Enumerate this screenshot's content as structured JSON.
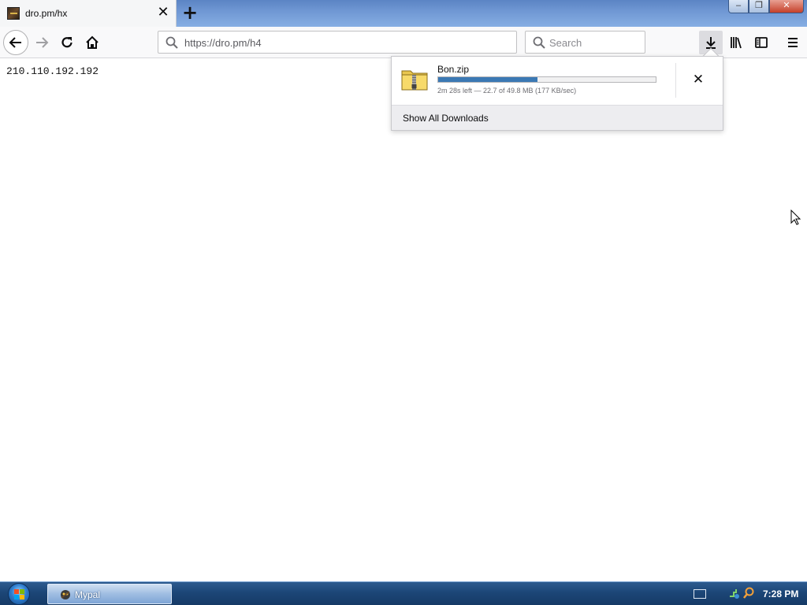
{
  "browser": {
    "tab": {
      "title": "dro.pm/hx"
    },
    "urlbar": {
      "url": "https://dro.pm/h4"
    },
    "searchbar": {
      "placeholder": "Search"
    }
  },
  "page": {
    "content_text": "210.110.192.192"
  },
  "downloads_panel": {
    "file_name": "Bon.zip",
    "progress": 0.456,
    "status": "2m 28s left — 22.7 of 49.8 MB (177 KB/sec)",
    "show_all_label": "Show All Downloads"
  },
  "taskbar": {
    "app_label": "Mypal",
    "clock": "7:28 PM"
  },
  "colors": {
    "progress_fill": "#3b79b4",
    "taskbar": "#1c4677",
    "tabstrip": "#6f97d3"
  },
  "icons": [
    "back-arrow-icon",
    "forward-arrow-icon",
    "reload-icon",
    "home-icon",
    "search-icon",
    "download-icon",
    "library-icon",
    "sidebar-icon",
    "hamburger-menu-icon",
    "zip-file-icon",
    "close-icon"
  ]
}
